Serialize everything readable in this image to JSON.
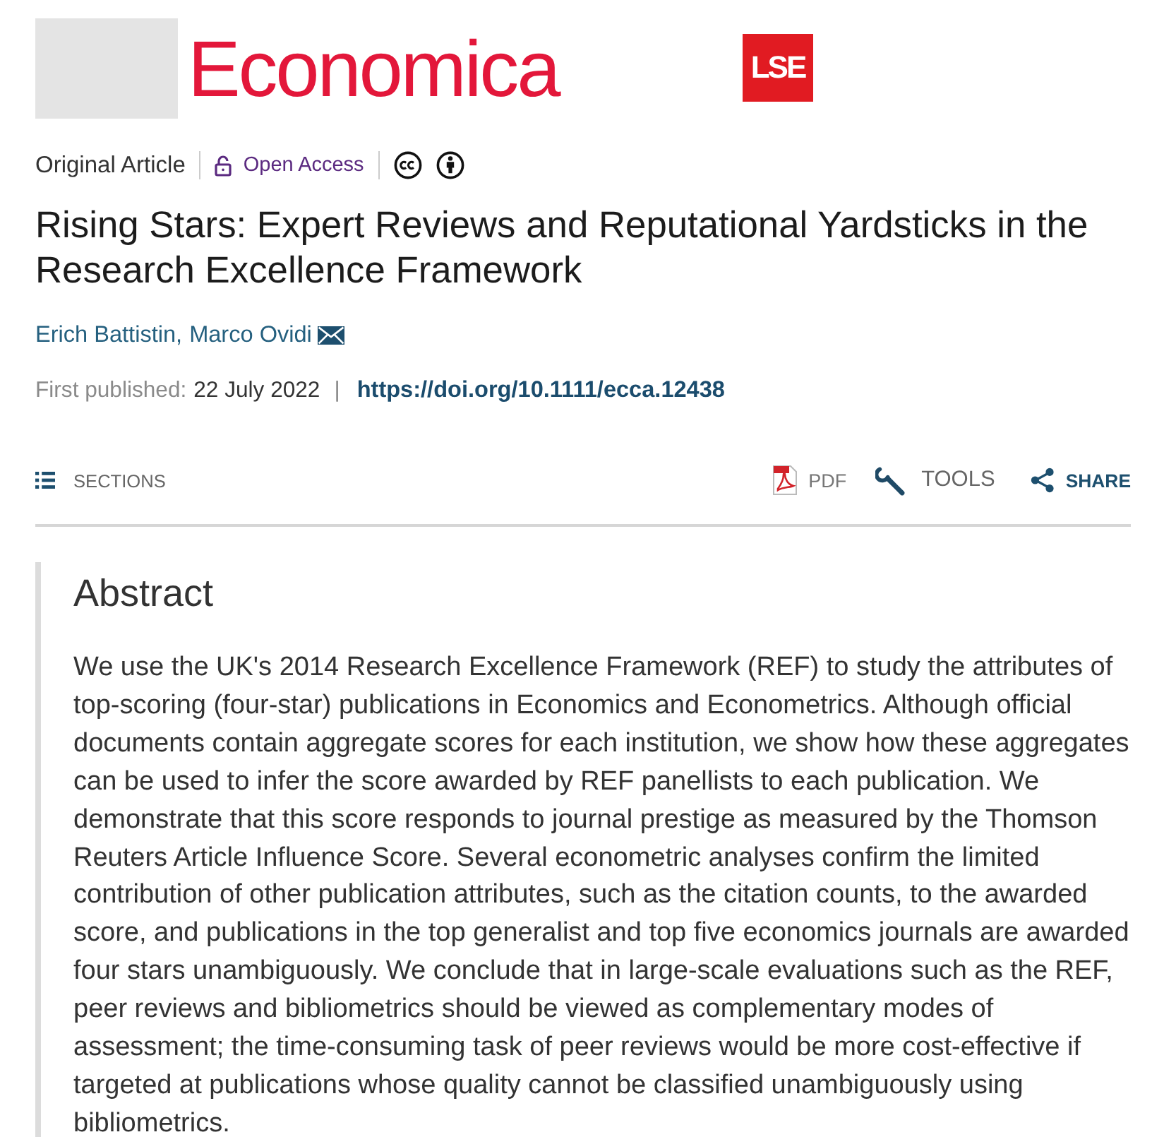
{
  "header": {
    "logo_text": "Economica",
    "badge": "LSE"
  },
  "article_meta": {
    "type": "Original Article",
    "access": "Open Access"
  },
  "title": "Rising Stars: Expert Reviews and Reputational Yardsticks in the Research Excellence Framework",
  "authors": [
    {
      "name": "Erich Battistin,",
      "corresponding": false
    },
    {
      "name": "Marco Ovidi",
      "corresponding": true
    }
  ],
  "publication": {
    "label": "First published:",
    "date": "22 July 2022",
    "separator": "|",
    "doi": "https://doi.org/10.1111/ecca.12438"
  },
  "toolbar": {
    "sections": "SECTIONS",
    "actions": [
      {
        "kind": "pdf",
        "label": "PDF"
      },
      {
        "kind": "tools",
        "label": "TOOLS"
      },
      {
        "kind": "share",
        "label": "SHARE"
      }
    ]
  },
  "abstract": {
    "heading": "Abstract",
    "text": "We use the UK's 2014 Research Excellence Framework (REF) to study the attributes of top-scoring (four-star) publications in Economics and Econometrics. Although official documents contain aggregate scores for each institution, we show how these aggregates can be used to infer the score awarded by REF panellists to each publication. We demonstrate that this score responds to journal prestige as measured by the Thomson Reuters Article Influence Score. Several econometric analyses confirm the limited contribution of other publication attributes, such as the citation counts, to the awarded score, and publications in the top generalist and top five economics journals are awarded four stars unambiguously. We conclude that in large-scale evaluations such as the REF, peer reviews and bibliometrics should be viewed as complementary modes of assessment; the time-consuming task of peer reviews would be more cost-effective if targeted at publications whose quality cannot be classified unambiguously using bibliometrics."
  }
}
